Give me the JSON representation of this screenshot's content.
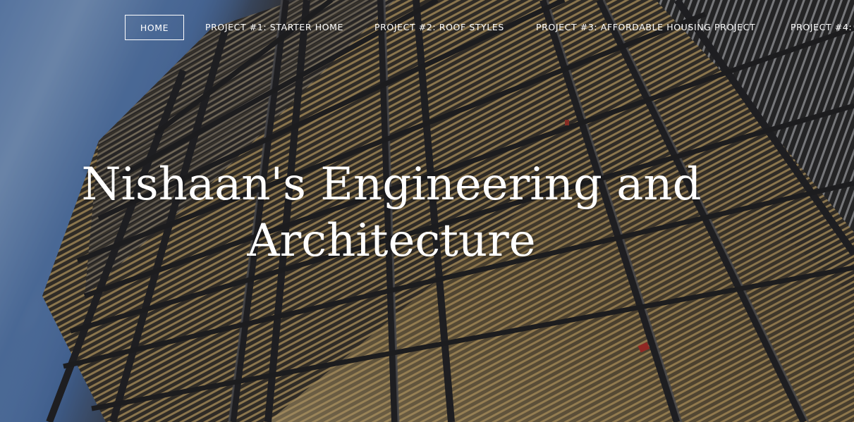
{
  "nav": {
    "items": [
      {
        "label": "HOME",
        "active": true
      },
      {
        "label": "PROJECT #1: STARTER HOME"
      },
      {
        "label": "PROJECT #2: ROOF STYLES"
      },
      {
        "label": "PROJECT #3: AFFORDABLE HOUSING PROJECT"
      },
      {
        "label": "PROJECT #4:"
      }
    ]
  },
  "hero": {
    "title_line1": "Nishaan's Engineering and",
    "title_line2": "Architecture",
    "background_image": "glass-and-steel-building-facade-photo"
  },
  "colors": {
    "text": "#ffffff",
    "sky": "#5e88c6",
    "frame": "#2b2b2e",
    "warm_light": "#c9a35a"
  }
}
